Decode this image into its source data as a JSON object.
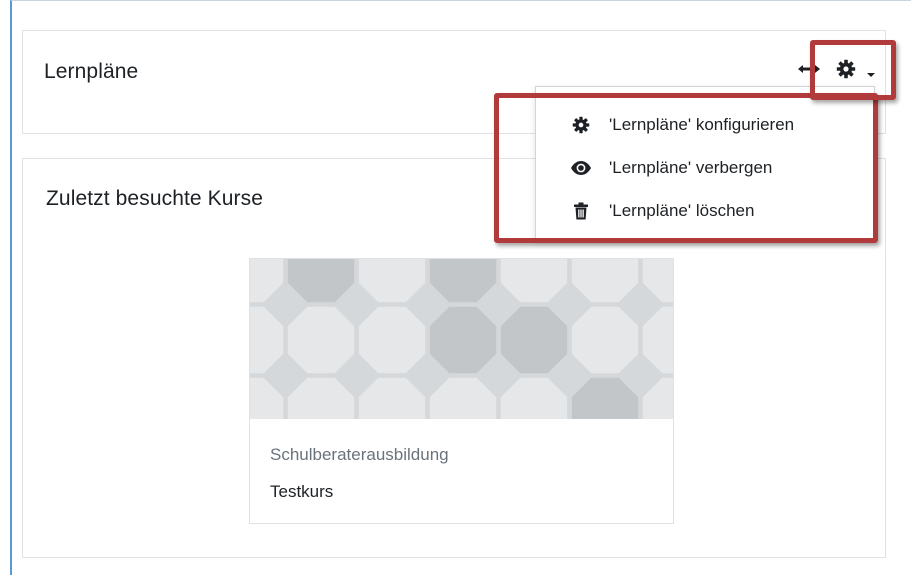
{
  "lernplaene_block": {
    "title": "Lernpläne",
    "icons": {
      "move": "move-arrows-icon",
      "settings": "gear-icon",
      "menu": "caret-down-icon"
    }
  },
  "dropdown": {
    "items": [
      {
        "label": "'Lernpläne' konfigurieren",
        "icon": "gear-icon"
      },
      {
        "label": "'Lernpläne' verbergen",
        "icon": "eye-icon"
      },
      {
        "label": "'Lernpläne' löschen",
        "icon": "trash-icon"
      }
    ]
  },
  "recent_block": {
    "title": "Zuletzt besuchte Kurse",
    "course": {
      "category": "Schulberaterausbildung",
      "name": "Testkurs"
    }
  },
  "colors": {
    "highlight": "#b13a3a",
    "pattern_light": "#e5e7e8",
    "pattern_dark": "#c3c6c8"
  }
}
